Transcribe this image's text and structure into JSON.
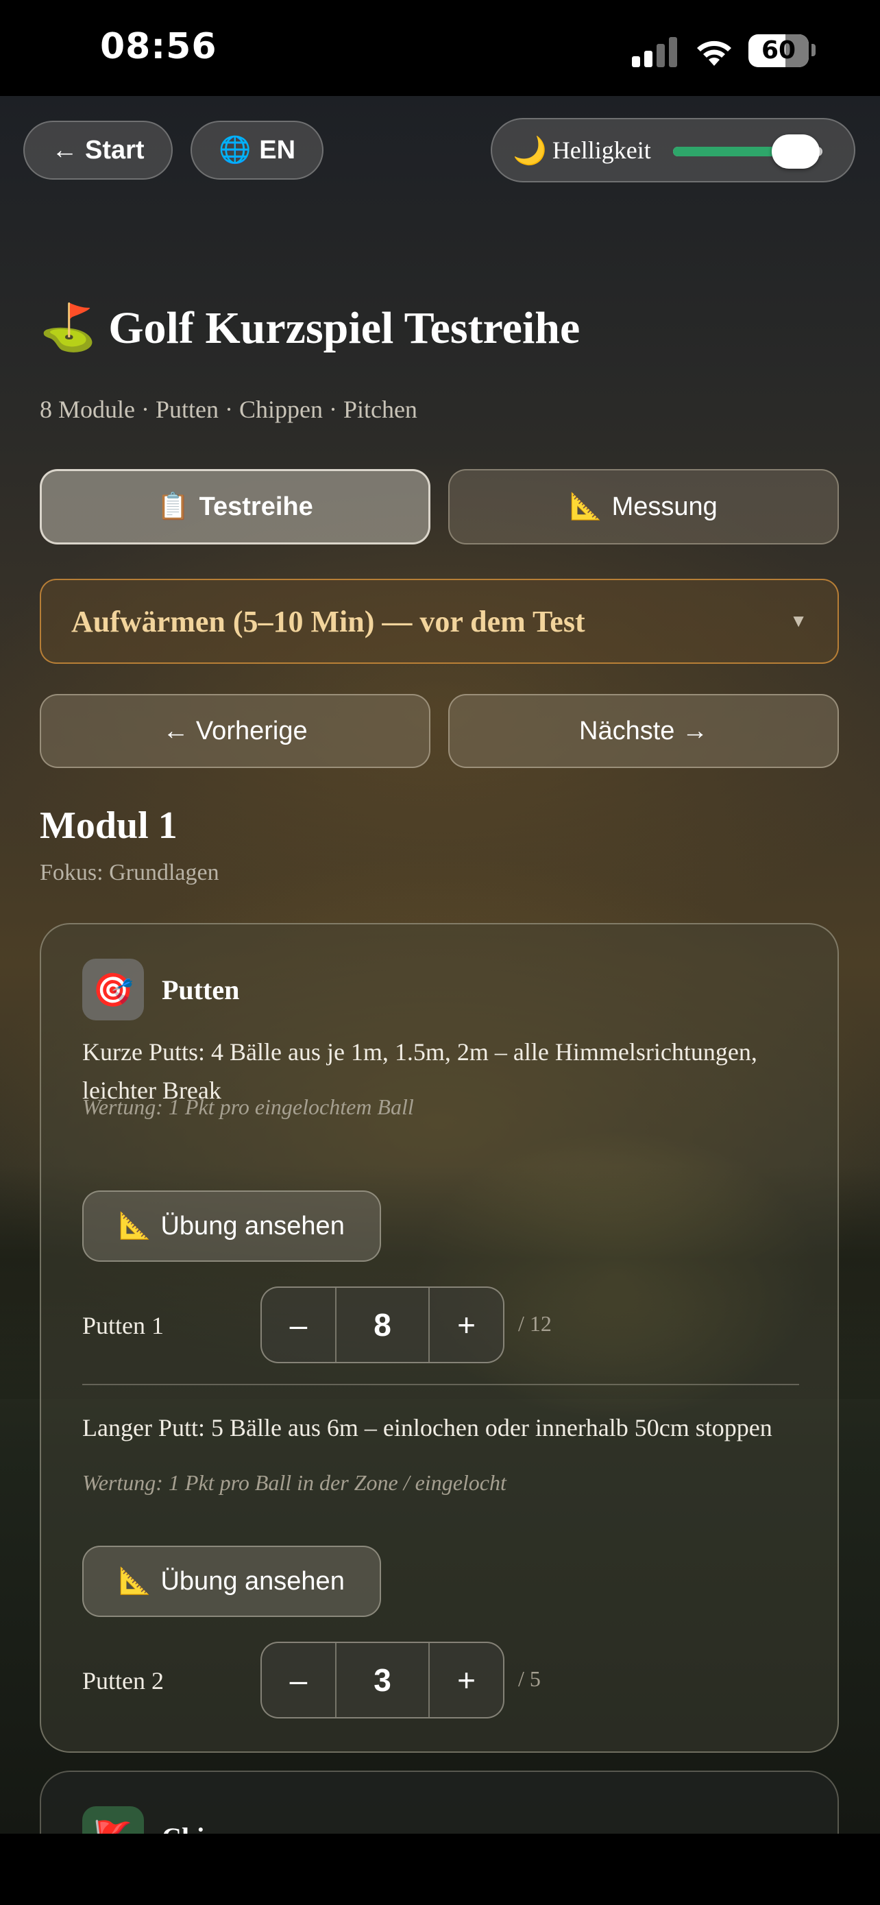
{
  "status_bar": {
    "time": "08:56",
    "battery": "60"
  },
  "top_bar": {
    "back_label": "← Start",
    "language_icon": "🌐",
    "language_label": "EN",
    "brightness_icon": "🌙",
    "brightness_label": "Helligkeit",
    "brightness_level": 0.82,
    "slider_color": "#2ea66a"
  },
  "header": {
    "title_icon": "⛳",
    "title": "Golf Kurzspiel Testreihe",
    "subtitle": "8 Module · Putten · Chippen · Pitchen"
  },
  "tabs": [
    {
      "icon": "📋",
      "label": "Testreihe",
      "active": true
    },
    {
      "icon": "📐",
      "label": "Messung",
      "active": false
    }
  ],
  "selector": {
    "value": "Aufwärmen (5–10 Min) — vor dem Test",
    "caret": "▼"
  },
  "nav": {
    "prev_label": "← Vorherige",
    "next_label": "Nächste →"
  },
  "module": {
    "title": "Modul 1",
    "focus": "Fokus: Grundlagen",
    "cards": [
      {
        "icon": "🎯",
        "title": "Putten",
        "exercises": [
          {
            "description": "Kurze Putts: 4 Bälle aus je 1m, 1.5m, 2m – alle Himmelsrichtungen, leichter Break",
            "scoring": "Wertung: 1 Pkt pro eingelochtem Ball",
            "view_icon": "📐",
            "view_label": "Übung ansehen",
            "score_label": "Putten 1",
            "value": "8",
            "max": "/ 12"
          },
          {
            "description": "Langer Putt: 5 Bälle aus 6m – einlochen oder innerhalb 50cm stoppen",
            "scoring": "Wertung: 1 Pkt pro Ball in der Zone / eingelocht",
            "view_icon": "📐",
            "view_label": "Übung ansehen",
            "score_label": "Putten 2",
            "value": "3",
            "max": "/ 5"
          }
        ]
      },
      {
        "icon": "🚩",
        "title": "Chippen"
      }
    ]
  },
  "stepper": {
    "minus": "–",
    "plus": "+"
  },
  "colors": {
    "accent_border": "#dc963c",
    "selector_text": "#f2d49c"
  }
}
